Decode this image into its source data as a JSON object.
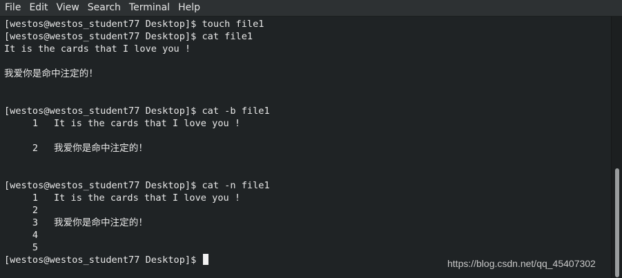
{
  "menubar": {
    "items": [
      "File",
      "Edit",
      "View",
      "Search",
      "Terminal",
      "Help"
    ]
  },
  "terminal": {
    "lines": [
      {
        "prefix": "",
        "text": "[westos@westos_student77 Desktop]$ touch file1"
      },
      {
        "prefix": "",
        "text": "[westos@westos_student77 Desktop]$ cat file1"
      },
      {
        "prefix": "",
        "text": "It is the cards that I love you !"
      },
      {
        "prefix": "",
        "text": ""
      },
      {
        "prefix": "",
        "text": "我爱你是命中注定的！"
      },
      {
        "prefix": "",
        "text": ""
      },
      {
        "prefix": "",
        "text": ""
      },
      {
        "prefix": "",
        "text": "[westos@westos_student77 Desktop]$ cat -b file1"
      },
      {
        "prefix": "     1",
        "text": "It is the cards that I love you !"
      },
      {
        "prefix": "",
        "text": ""
      },
      {
        "prefix": "     2",
        "text": "我爱你是命中注定的！"
      },
      {
        "prefix": "",
        "text": ""
      },
      {
        "prefix": "",
        "text": ""
      },
      {
        "prefix": "[westos@westos_student77 Desktop]$ cat -n file1",
        "text": ""
      },
      {
        "prefix": "     1",
        "text": "It is the cards that I love you !"
      },
      {
        "prefix": "     2",
        "text": ""
      },
      {
        "prefix": "     3",
        "text": "我爱你是命中注定的！"
      },
      {
        "prefix": "     4",
        "text": ""
      },
      {
        "prefix": "     5",
        "text": ""
      },
      {
        "prefix": "",
        "text": "[westos@westos_student77 Desktop]$ "
      }
    ]
  },
  "watermark": "https://blog.csdn.net/qq_45407302"
}
